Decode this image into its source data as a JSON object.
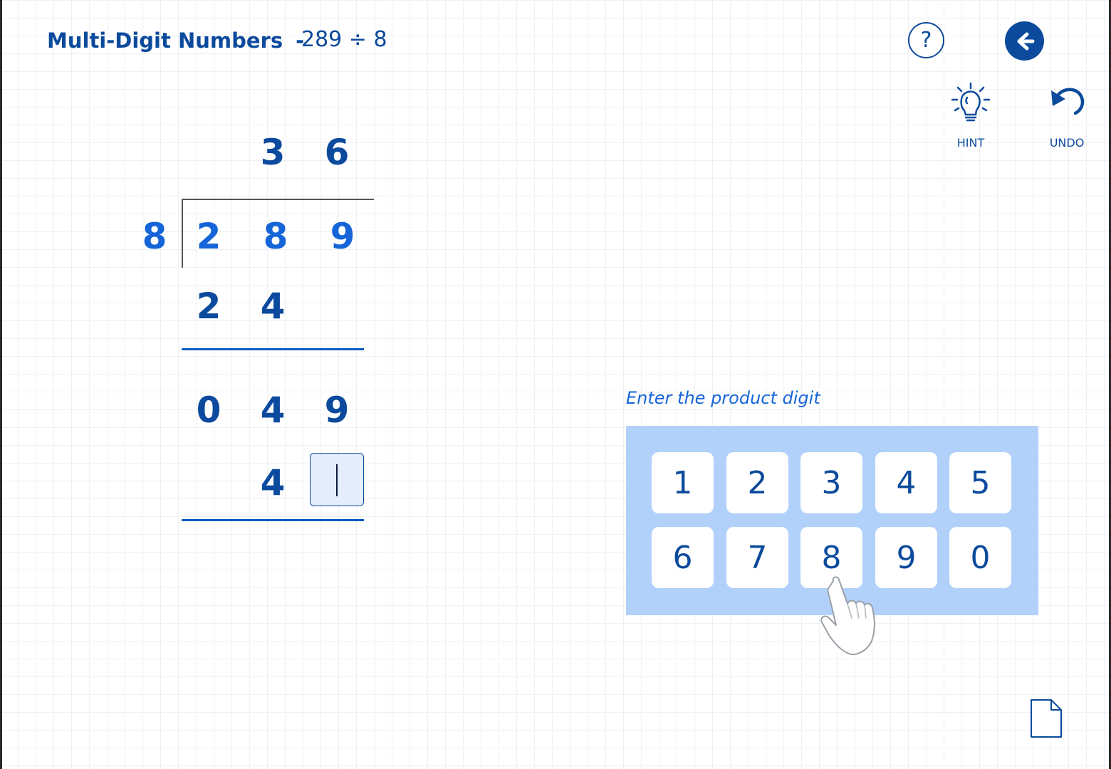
{
  "header": {
    "title": "Multi-Digit Numbers",
    "separator": "-",
    "problem": "289 ÷ 8"
  },
  "toolbar": {
    "help_label": "?",
    "hint_label": "HINT",
    "undo_label": "UNDO"
  },
  "division": {
    "quotient": [
      "3",
      "6"
    ],
    "divisor": "8",
    "dividend": [
      "2",
      "8",
      "9"
    ],
    "product_1": [
      "2",
      "4"
    ],
    "remainder_row": [
      "0",
      "4",
      "9"
    ],
    "product_2_digit": "4",
    "active_input_value": ""
  },
  "keypad": {
    "prompt": "Enter the product digit",
    "keys": [
      "1",
      "2",
      "3",
      "4",
      "5",
      "6",
      "7",
      "8",
      "9",
      "0"
    ]
  },
  "icons": {
    "back": "arrow-left-icon",
    "hint": "lightbulb-icon",
    "undo": "undo-icon",
    "document": "document-icon",
    "pointer": "hand-pointer-icon"
  },
  "colors": {
    "primary": "#0b4a9c",
    "accent": "#1565d8",
    "keypad_bg": "#b1d1fb",
    "input_bg": "#e3edfb"
  }
}
